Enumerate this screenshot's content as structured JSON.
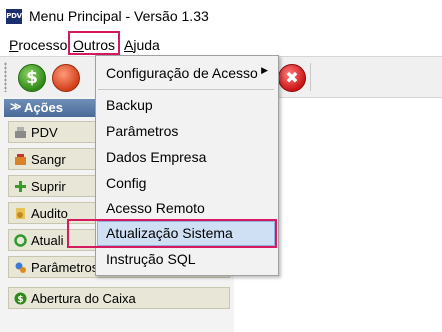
{
  "window": {
    "app_icon_text": "PDV",
    "title": "Menu Principal - Versão 1.33"
  },
  "menubar": {
    "items": [
      {
        "first": "P",
        "rest": "rocesso"
      },
      {
        "first": "O",
        "rest": "utros"
      },
      {
        "first": "A",
        "rest": "juda"
      }
    ]
  },
  "toolbar": {
    "green_button_glyph": "$",
    "red_button_glyph": "✖"
  },
  "panel": {
    "header": "Ações",
    "header_icon": "chevron-double-down-icon",
    "buttons": [
      {
        "label": "PDV",
        "icon": "register-icon"
      },
      {
        "label": "Sangr",
        "icon": "withdraw-icon"
      },
      {
        "label": "Suprir",
        "icon": "supply-icon"
      },
      {
        "label": "Audito",
        "icon": "audit-icon"
      },
      {
        "label": "Atuali",
        "icon": "refresh-icon"
      },
      {
        "label": "Parâmetros",
        "icon": "parameters-icon"
      },
      {
        "label": "Abertura do Caixa",
        "icon": "cash-open-icon"
      }
    ]
  },
  "dropdown": {
    "items": [
      "Configuração de Acesso",
      "Backup",
      "Parâmetros",
      "Dados Empresa",
      "Config",
      "Acesso Remoto",
      "Atualização Sistema",
      "Instrução SQL"
    ],
    "highlighted": "Atualização Sistema",
    "submenu_arrow": "▶"
  },
  "colors": {
    "highlight_box": "#d61a5f",
    "selection": "#cfe0f5",
    "panel_header": "#4a6a98"
  }
}
